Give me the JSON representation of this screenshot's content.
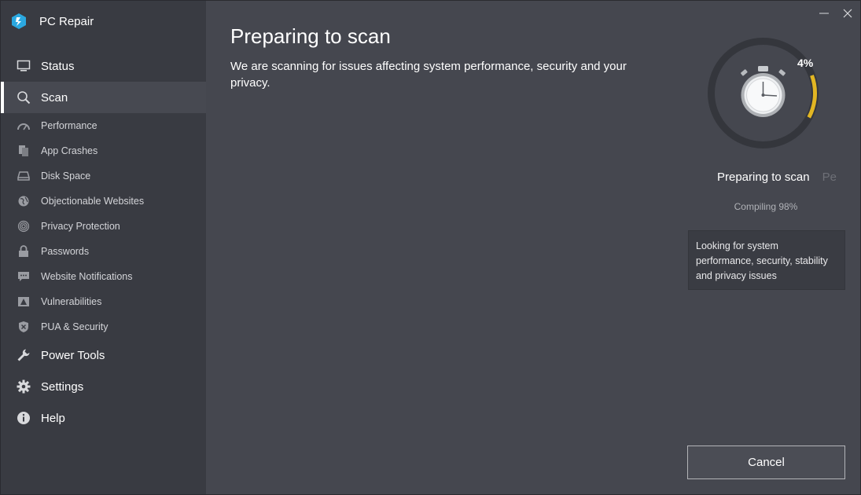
{
  "app": {
    "title": "PC Repair"
  },
  "nav": {
    "status": "Status",
    "scan": "Scan",
    "power_tools": "Power Tools",
    "settings": "Settings",
    "help": "Help"
  },
  "scan_items": [
    "Performance",
    "App Crashes",
    "Disk Space",
    "Objectionable Websites",
    "Privacy Protection",
    "Passwords",
    "Website Notifications",
    "Vulnerabilities",
    "PUA & Security"
  ],
  "main": {
    "title": "Preparing to scan",
    "description": "We are scanning for issues affecting system performance, security and your privacy."
  },
  "progress": {
    "percent_label": "4%",
    "percent_value": 4,
    "current_step": "Preparing to scan",
    "next_step": "Pe",
    "sub_status": "Compiling 98%",
    "info": "Looking for system performance, security, stability and privacy issues"
  },
  "actions": {
    "cancel": "Cancel"
  },
  "colors": {
    "progress_arc": "#e2b623",
    "track": "#34363c",
    "sidebar_bg": "#393b42",
    "main_bg": "#45474f",
    "logo": "#2ba8e0"
  },
  "icons": {
    "logo": "pc-repair-logo-icon",
    "status": "monitor-icon",
    "scan": "magnifier-icon",
    "gauge": "stopwatch-icon"
  }
}
